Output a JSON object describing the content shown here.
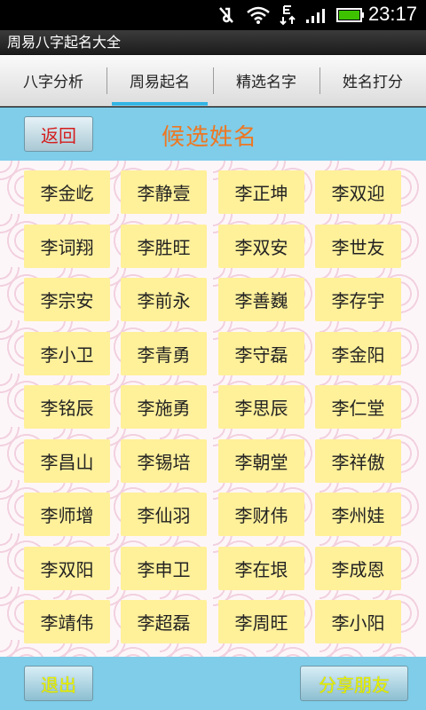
{
  "status": {
    "time": "23:17",
    "icons": [
      "mute-icon",
      "wifi-icon",
      "data-e-icon",
      "signal-icon",
      "battery-icon"
    ]
  },
  "app": {
    "title": "周易八字起名大全"
  },
  "tabs": [
    {
      "label": "八字分析",
      "active": false
    },
    {
      "label": "周易起名",
      "active": true
    },
    {
      "label": "精选名字",
      "active": false
    },
    {
      "label": "姓名打分",
      "active": false
    }
  ],
  "header": {
    "back_label": "返回",
    "title": "候选姓名"
  },
  "names": [
    "李金屹",
    "李静壹",
    "李正坤",
    "李双迎",
    "李词翔",
    "李胜旺",
    "李双安",
    "李世友",
    "李宗安",
    "李前永",
    "李善巍",
    "李存宇",
    "李小卫",
    "李青勇",
    "李守磊",
    "李金阳",
    "李铭辰",
    "李施勇",
    "李思辰",
    "李仁堂",
    "李昌山",
    "李锡培",
    "李朝堂",
    "李祥傲",
    "李师增",
    "李仙羽",
    "李财伟",
    "李州娃",
    "李双阳",
    "李申卫",
    "李在垠",
    "李成恩",
    "李靖伟",
    "李超磊",
    "李周旺",
    "李小阳"
  ],
  "footer": {
    "exit_label": "退出",
    "share_label": "分享朋友"
  },
  "colors": {
    "accent_blue": "#33b5e5",
    "header_bg": "#7fcde8",
    "card_bg": "#fff09a",
    "title_orange": "#ee7722",
    "back_red": "#d41d1d",
    "footer_yellow": "#e8f200"
  }
}
